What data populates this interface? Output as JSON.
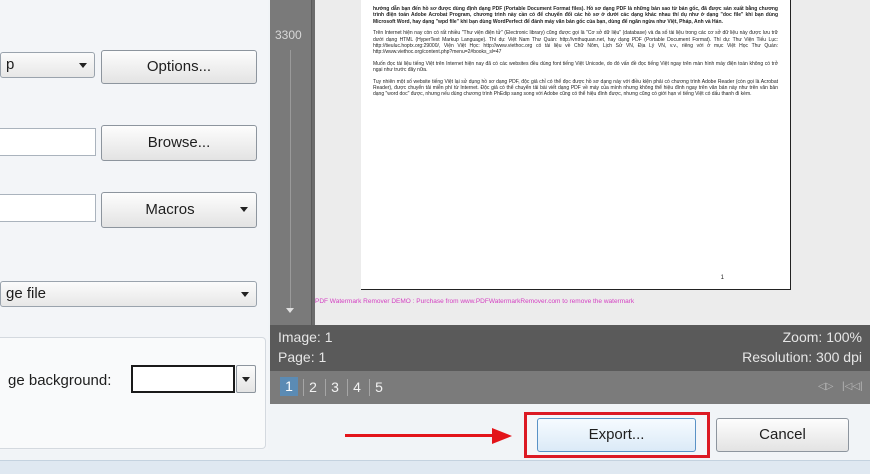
{
  "left_panel": {
    "combo_top_label": "p",
    "options_button": "Options...",
    "browse_button": "Browse...",
    "macros_button": "Macros",
    "file_combo_label": "ge file",
    "background_label": "ge background:"
  },
  "preview": {
    "ruler_label": "3300",
    "document_paragraphs": [
      "hướng dẫn bạn đến hồ sơ được dùng định dạng PDF (Portable Document Format files). Hồ sơ dạng PDF là những bản sao từ bản gốc, đã được sản xuất bằng chương trình điện toán Adobe Acrobat Program, chương trình này cần có để chuyển đổi các hồ sơ ở dưới các dạng khác nhau thí dụ như ở dạng \"doc file\" khi bạn dùng Microsoft Word, hay dạng \"wpd file\" khi bạn dùng WordPerfect để đánh máy văn bản gốc của bạn, dùng để ngăn ngừa như Việt, Pháp, Anh và Hán.",
      "Trên Internet hiện nay còn có rất nhiều \"Thư viện điện tử\" (Electronic library) cũng được gọi là \"Cơ sở dữ liệu\" (database) và đa số tài liệu trong các cơ sở dữ liệu này được lưu trữ dưới dạng HTML (HyperText Markup Language). Thí dụ: Việt Nam Thư Quán: http://vnthuquan.net, hay dạng PDF (Portable Document Format). Thí dụ: Thư Viện Tiếu Lục: http://tieuluc.hoptx.org:29000/, Viện Việt Học: http://www.viethoc.org có tài liệu về Chữ Nôm, Lịch Sử VN, Địa Lý VN, v.v., riêng với ở mục Việt Học Thư Quán: http://www.viethoc.org/content.php?menu=2#books_sl=47",
      "Muốn đọc tài liệu tiếng Việt trên Internet hiện nay đã có các websites đều dùng font tiếng Việt Unicode, do đó vấn đề đọc tiếng Việt ngay trên màn hình máy điện toán không có trở ngại như trước đây nữa.",
      "Tuy nhiên một số website tiếng Việt lại sử dụng hồ sơ dạng PDF, độc giả chỉ có thể đọc được hồ sơ dạng này với điều kiện phải có chương trình Adobe Reader (còn gọi là Acrobat Reader), được chuyển tải miễn phí từ Internet. Độc giả có thể chuyển tải bài viết dạng PDF về máy của mình nhưng không thể hiệu đính ngay trên văn bản này như trên văn bản dạng \"word doc\" được, nhưng nếu dùng chương trình PhEdip sang song với Adobe cũng có thể hiệu đính được, nhưng cũng có giới hạn vì tiếng Việt có dấu thanh đi kèm."
    ],
    "page_number_text": "1",
    "watermark": "PDF Watermark Remover DEMO : Purchase from www.PDFWatermarkRemover.com to remove the watermark",
    "image_label": "Image: 1",
    "page_label": "Page: 1",
    "zoom_label": "Zoom: 100%",
    "resolution_label": "Resolution: 300 dpi",
    "pages": [
      "1",
      "2",
      "3",
      "4",
      "5"
    ],
    "nav_prev_icon": "step-back-icon",
    "nav_first_icon": "first-page-icon"
  },
  "footer": {
    "export_button": "Export...",
    "cancel_button": "Cancel"
  },
  "colors": {
    "highlight": "#dc1a24",
    "arrow": "#e3141a",
    "active_page": "#5b8bb4",
    "watermark": "#d43fc2"
  }
}
